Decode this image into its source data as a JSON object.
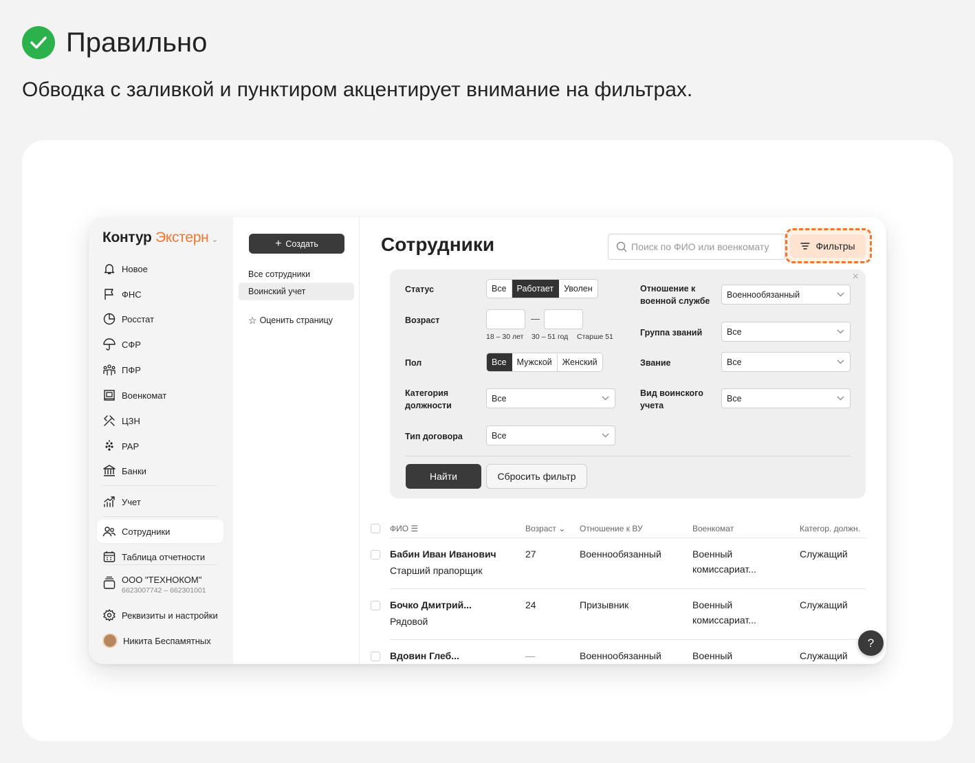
{
  "header": {
    "title": "Правильно",
    "description": "Обводка с заливкой и пунктиром акцентирует внимание на фильтрах."
  },
  "colors": {
    "accent": "#f2762e",
    "check": "#2bb24c",
    "dark": "#3a3a3a"
  },
  "sidebar": {
    "logo_part1": "Контур",
    "logo_part2": "Экстерн",
    "items": [
      {
        "label": "Новое",
        "icon": "bell-icon"
      },
      {
        "label": "ФНС",
        "icon": "flag-icon"
      },
      {
        "label": "Росстат",
        "icon": "pie-chart-icon"
      },
      {
        "label": "СФР",
        "icon": "umbrella-icon"
      },
      {
        "label": "ПФР",
        "icon": "people-icon"
      },
      {
        "label": "Военкомат",
        "icon": "military-icon"
      },
      {
        "label": "ЦЗН",
        "icon": "tools-icon"
      },
      {
        "label": "РАР",
        "icon": "grapes-icon"
      },
      {
        "label": "Банки",
        "icon": "bank-icon"
      },
      {
        "label": "Учет",
        "icon": "growth-chart-icon"
      },
      {
        "label": "Сотрудники",
        "icon": "employees-icon"
      },
      {
        "label": "Таблица отчетности",
        "icon": "calendar-icon"
      }
    ],
    "org_name": "ООО \"ТЕХНОКОМ\"",
    "org_ids": "6623007742 – 662301001",
    "settings_label": "Реквизиты и настройки",
    "user_name": "Никита Беспамятных"
  },
  "subnav": {
    "create_label": "Создать",
    "items": [
      "Все сотрудники",
      "Воинский учет"
    ],
    "rate_label": "Оценить страницу"
  },
  "main": {
    "title": "Сотрудники",
    "search_placeholder": "Поиск по ФИО или военкомату",
    "filters_label": "Фильтры"
  },
  "filters": {
    "close": "×",
    "status_label": "Статус",
    "status_options": [
      "Все",
      "Работает",
      "Уволен"
    ],
    "age_label": "Возраст",
    "age_dash": "—",
    "age_hints": [
      "18 – 30 лет",
      "30 – 51 год",
      "Старше 51"
    ],
    "gender_label": "Пол",
    "gender_options": [
      "Все",
      "Мужской",
      "Женский"
    ],
    "category_label": "Категория должности",
    "category_value": "Все",
    "contract_label": "Тип договора",
    "contract_value": "Все",
    "military_label": "Отношение к военной службе",
    "military_value": "Военнообязанный",
    "rank_group_label": "Группа званий",
    "rank_group_value": "Все",
    "rank_label": "Звание",
    "rank_value": "Все",
    "record_type_label": "Вид воинского учета",
    "record_type_value": "Все",
    "find_label": "Найти",
    "reset_label": "Сбросить фильтр"
  },
  "table": {
    "headers": [
      "ФИО",
      "Возраст",
      "Отношение к ВУ",
      "Военкомат",
      "Категор. должн."
    ],
    "rows": [
      {
        "name": "Бабин Иван Иванович",
        "rank": "Старший прапорщик",
        "age": "27",
        "relation": "Военнообязанный",
        "office1": "Военный",
        "office2": "комиссариат...",
        "category": "Служащий"
      },
      {
        "name": "Бочко Дмитрий...",
        "rank": "Рядовой",
        "age": "24",
        "relation": "Призывник",
        "office1": "Военный",
        "office2": "комиссариат...",
        "category": "Служащий"
      },
      {
        "name": "Вдовин Глеб...",
        "rank": "",
        "age": "—",
        "relation": "Военнообязанный",
        "office1": "Военный",
        "office2": "",
        "category": "Служащий"
      }
    ]
  },
  "help_label": "?"
}
